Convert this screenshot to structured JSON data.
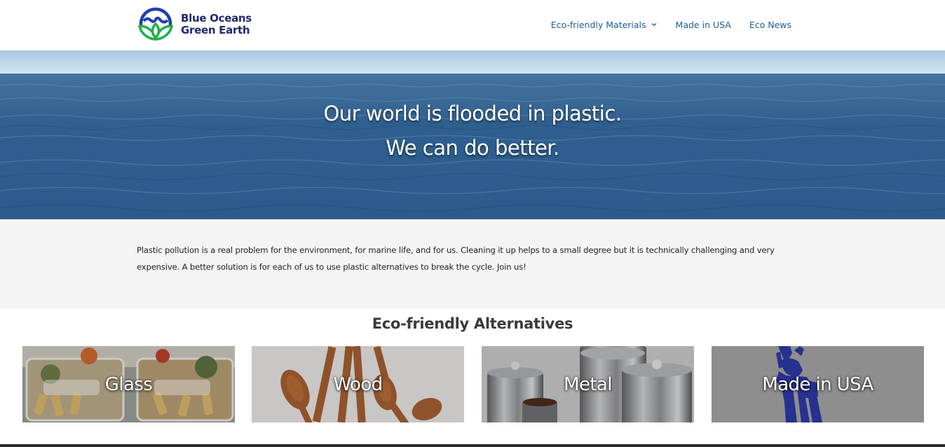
{
  "brand": {
    "line1": "Blue Oceans",
    "line2": "Green Earth",
    "colors": {
      "blue": "#1f3fa8",
      "green": "#1fae4b",
      "text": "#1c2a6e"
    }
  },
  "nav": {
    "items": [
      {
        "label": "Eco-friendly Materials",
        "has_dropdown": true,
        "icon": "chevron-down-icon"
      },
      {
        "label": "Made in USA",
        "has_dropdown": false
      },
      {
        "label": "Eco News",
        "has_dropdown": false
      }
    ],
    "link_color": "#1a5e9a"
  },
  "hero": {
    "line1": "Our world is flooded in plastic.",
    "line2": "We can do better."
  },
  "intro": {
    "text": "Plastic pollution is a real problem for the environment, for marine life, and for us. Cleaning it up helps to a small degree but it is technically challenging and very expensive. A better solution is for each of us to use plastic alternatives to break the cycle. Join us!"
  },
  "alternatives": {
    "title": "Eco-friendly Alternatives",
    "tiles": [
      {
        "label": "Glass"
      },
      {
        "label": "Wood"
      },
      {
        "label": "Metal"
      },
      {
        "label": "Made in USA"
      }
    ]
  }
}
